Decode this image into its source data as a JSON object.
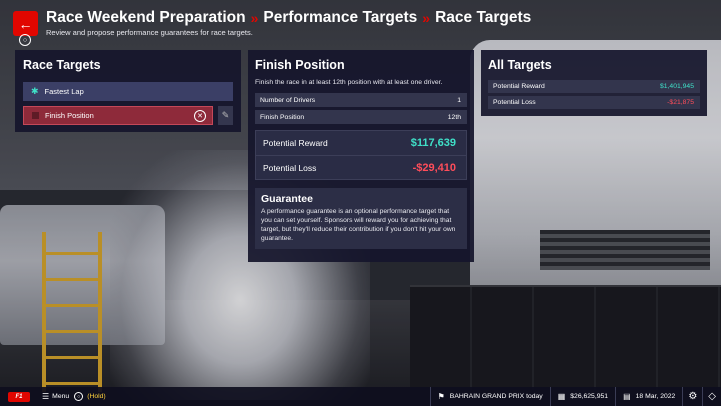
{
  "header": {
    "back_icon": "back-arrow-icon",
    "breadcrumb": [
      "Race Weekend Preparation",
      "Performance Targets",
      "Race Targets"
    ],
    "separator": "»",
    "subtitle": "Review and propose performance guarantees for race targets."
  },
  "race_targets": {
    "title": "Race Targets",
    "items": [
      {
        "label": "Fastest Lap",
        "icon": "star-icon"
      },
      {
        "label": "Finish Position",
        "icon": "checkbox-icon"
      }
    ]
  },
  "finish_position": {
    "title": "Finish Position",
    "description": "Finish the race in at least 12th position with at least one driver.",
    "rows": [
      {
        "label": "Number of Drivers",
        "value": "1"
      },
      {
        "label": "Finish Position",
        "value": "12th"
      }
    ],
    "potential_reward_label": "Potential Reward",
    "potential_reward_value": "$117,639",
    "potential_loss_label": "Potential Loss",
    "potential_loss_value": "-$29,410",
    "guarantee_title": "Guarantee",
    "guarantee_text": "A performance guarantee is an optional performance target that you can set yourself. Sponsors will reward you for achieving that target, but they'll reduce their contribution if you don't hit your own guarantee."
  },
  "all_targets": {
    "title": "All Targets",
    "potential_reward_label": "Potential Reward",
    "potential_reward_value": "$1,401,945",
    "potential_loss_label": "Potential Loss",
    "potential_loss_value": "-$21,875"
  },
  "footer": {
    "logo": "F1",
    "menu_label": "Menu",
    "hold_label": "(Hold)",
    "event": "BAHRAIN GRAND PRIX today",
    "balance": "$26,625,951",
    "date": "18 Mar, 2022"
  },
  "colors": {
    "accent_red": "#e10600",
    "positive": "#3fe0c8",
    "negative": "#ff4d5a",
    "panel": "#16162c"
  }
}
